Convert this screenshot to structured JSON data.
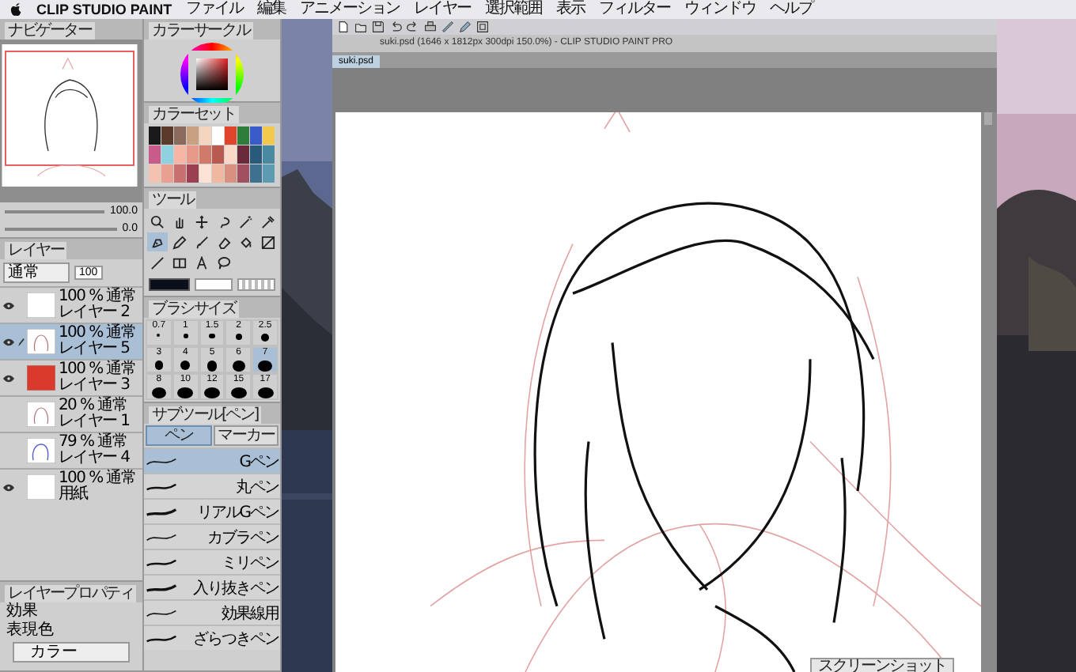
{
  "menu": {
    "app": "CLIP STUDIO PAINT",
    "items": [
      "ファイル",
      "編集",
      "アニメーション",
      "レイヤー",
      "選択範囲",
      "表示",
      "フィルター",
      "ウィンドウ",
      "ヘルプ"
    ]
  },
  "navigator": {
    "title": "ナビゲーター",
    "zoom": "100.0",
    "angle": "0.0"
  },
  "layers": {
    "title": "レイヤー",
    "blend": "通常",
    "opacity": "100",
    "items": [
      {
        "info": "100 % 通常",
        "name": "レイヤー 2",
        "visible": true,
        "editing": false,
        "selected": false,
        "kind": "blank"
      },
      {
        "info": "100 % 通常",
        "name": "レイヤー 5",
        "visible": true,
        "editing": true,
        "selected": true,
        "kind": "sketch"
      },
      {
        "info": "100 % 通常",
        "name": "レイヤー 3",
        "visible": true,
        "editing": false,
        "selected": false,
        "kind": "fill",
        "color": "#d93a2b"
      },
      {
        "info": "20 % 通常",
        "name": "レイヤー 1",
        "visible": false,
        "editing": false,
        "selected": false,
        "kind": "sketch"
      },
      {
        "info": "79 % 通常",
        "name": "レイヤー 4",
        "visible": false,
        "editing": false,
        "selected": false,
        "kind": "bluesketch"
      },
      {
        "info": "100 % 通常",
        "name": "用紙",
        "visible": true,
        "editing": false,
        "selected": false,
        "kind": "blank"
      }
    ]
  },
  "layer_property": {
    "title": "レイヤープロパティ",
    "effect_label": "効果",
    "color_label": "表現色",
    "color_value": "カラー"
  },
  "color_circle": {
    "title": "カラーサークル"
  },
  "color_set": {
    "title": "カラーセット"
  },
  "tool": {
    "title": "ツール",
    "items": [
      {
        "kind": "zoom",
        "selected": false
      },
      {
        "kind": "hand",
        "selected": false
      },
      {
        "kind": "move",
        "selected": false
      },
      {
        "kind": "lasso",
        "selected": false
      },
      {
        "kind": "wand",
        "selected": false
      },
      {
        "kind": "dropper",
        "selected": false
      },
      {
        "kind": "pen",
        "selected": true
      },
      {
        "kind": "pencil",
        "selected": false
      },
      {
        "kind": "brush",
        "selected": false
      },
      {
        "kind": "eraser",
        "selected": false
      },
      {
        "kind": "fill",
        "selected": false
      },
      {
        "kind": "gradient",
        "selected": false
      },
      {
        "kind": "line",
        "selected": false
      },
      {
        "kind": "frame",
        "selected": false
      },
      {
        "kind": "text",
        "selected": false
      },
      {
        "kind": "balloon",
        "selected": false
      }
    ]
  },
  "brush_size": {
    "title": "ブラシサイズ",
    "items": [
      {
        "label": "0.7",
        "selected": false
      },
      {
        "label": "1",
        "selected": false
      },
      {
        "label": "1.5",
        "selected": false
      },
      {
        "label": "2",
        "selected": false
      },
      {
        "label": "2.5",
        "selected": false
      },
      {
        "label": "3",
        "selected": false
      },
      {
        "label": "4",
        "selected": false
      },
      {
        "label": "5",
        "selected": false
      },
      {
        "label": "6",
        "selected": false
      },
      {
        "label": "7",
        "selected": true
      },
      {
        "label": "8",
        "selected": false
      },
      {
        "label": "10",
        "selected": false
      },
      {
        "label": "12",
        "selected": false
      },
      {
        "label": "15",
        "selected": false
      },
      {
        "label": "17",
        "selected": false
      }
    ]
  },
  "sub_tool": {
    "title": "サブツール[ペン]",
    "tabs": [
      {
        "label": "ペン",
        "selected": true
      },
      {
        "label": "マーカー",
        "selected": false
      }
    ],
    "items": [
      {
        "name": "Gペン",
        "selected": true
      },
      {
        "name": "丸ペン",
        "selected": false
      },
      {
        "name": "リアルGペン",
        "selected": false
      },
      {
        "name": "カブラペン",
        "selected": false
      },
      {
        "name": "ミリペン",
        "selected": false
      },
      {
        "name": "入り抜きペン",
        "selected": false
      },
      {
        "name": "効果線用",
        "selected": false
      },
      {
        "name": "ざらつきペン",
        "selected": false
      }
    ]
  },
  "canvas": {
    "title": "suki.psd (1646 x 1812px 300dpi 150.0%) - CLIP STUDIO PAINT PRO",
    "tab": "suki.psd"
  },
  "screenshot_button": "スクリーンショット"
}
